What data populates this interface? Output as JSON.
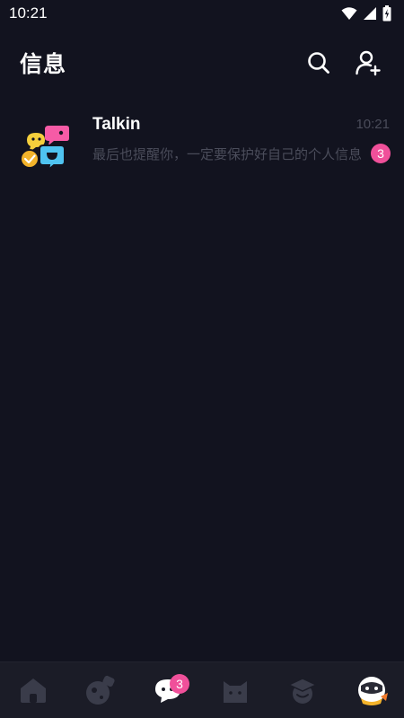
{
  "status_bar": {
    "time": "10:21",
    "icons": [
      "wifi-icon",
      "signal-icon",
      "battery-charging-icon"
    ]
  },
  "header": {
    "title": "信息",
    "actions": [
      "search-icon",
      "add-friend-icon"
    ]
  },
  "chats": [
    {
      "name": "Talkin",
      "time": "10:21",
      "preview": "最后也提醒你，一定要保护好自己的个人信息",
      "unread": "3",
      "avatar_icon": "talkin-chat-bubbles-icon",
      "verified": true
    }
  ],
  "bottom_nav": {
    "items": [
      {
        "icon": "home-icon",
        "active": false
      },
      {
        "icon": "planet-icon",
        "active": false
      },
      {
        "icon": "messages-icon",
        "active": true,
        "badge": "3"
      },
      {
        "icon": "cat-icon",
        "active": false
      },
      {
        "icon": "graduation-cap-icon",
        "active": false
      },
      {
        "icon": "astronaut-avatar-icon",
        "active": false
      }
    ]
  },
  "colors": {
    "background": "#12131f",
    "nav_background": "#1b1c27",
    "badge": "#f0509a",
    "muted_text": "#4a4c5a",
    "nav_icon": "#3a3c4a"
  }
}
